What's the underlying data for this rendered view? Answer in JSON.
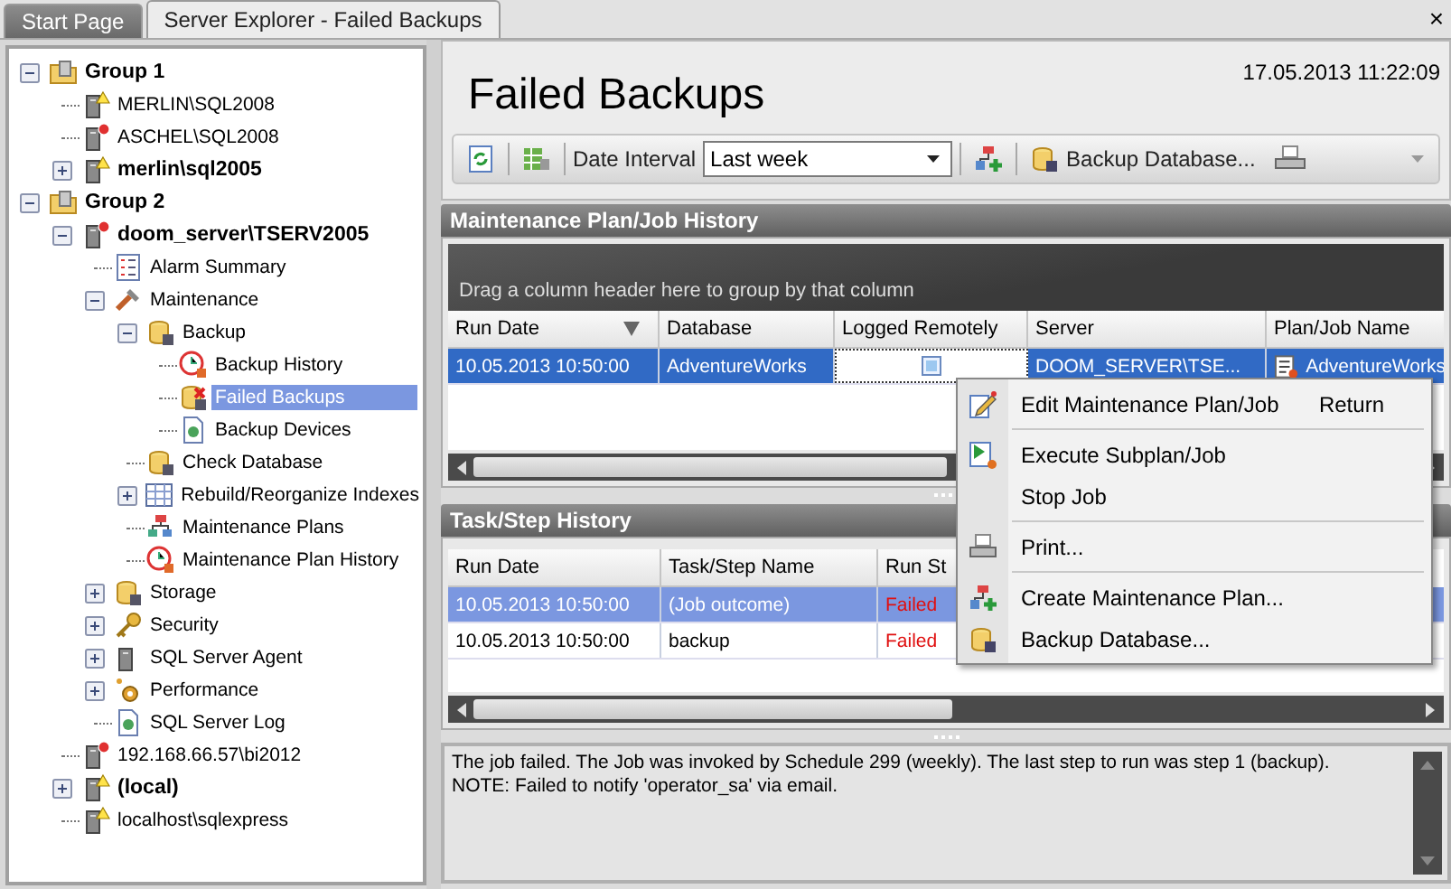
{
  "tabs": [
    {
      "label": "Start Page",
      "selected": false
    },
    {
      "label": "Server Explorer - Failed Backups",
      "selected": true
    }
  ],
  "close": "×",
  "tree": [
    {
      "label": "Group 1",
      "kind": "group",
      "bold": true,
      "selected": false,
      "expanded": true,
      "children": [
        {
          "label": "MERLIN\\SQL2008",
          "kind": "server",
          "warning": true,
          "error": false,
          "bold": false,
          "selected": false
        },
        {
          "label": "ASCHEL\\SQL2008",
          "kind": "server",
          "warning": false,
          "error": true,
          "bold": false,
          "selected": false
        },
        {
          "label": "merlin\\sql2005",
          "kind": "server",
          "warning": true,
          "error": false,
          "bold": true,
          "selected": false,
          "expanded": false
        }
      ]
    },
    {
      "label": "Group 2",
      "kind": "group",
      "bold": true,
      "selected": false,
      "expanded": true,
      "children": [
        {
          "label": "doom_server\\TSERV2005",
          "kind": "server",
          "warning": false,
          "error": true,
          "bold": true,
          "selected": false,
          "expanded": true,
          "children": [
            {
              "label": "Alarm Summary",
              "kind": "alarm",
              "bold": false,
              "selected": false
            },
            {
              "label": "Maintenance",
              "kind": "maintenance",
              "bold": false,
              "selected": false,
              "expanded": true,
              "children": [
                {
                  "label": "Backup",
                  "kind": "backup",
                  "bold": false,
                  "selected": false,
                  "expanded": true,
                  "children": [
                    {
                      "label": "Backup History",
                      "kind": "history",
                      "bold": false,
                      "selected": false
                    },
                    {
                      "label": "Failed Backups",
                      "kind": "failed",
                      "bold": false,
                      "selected": true
                    },
                    {
                      "label": "Backup Devices",
                      "kind": "device",
                      "bold": false,
                      "selected": false
                    }
                  ]
                },
                {
                  "label": "Check Database",
                  "kind": "check",
                  "bold": false,
                  "selected": false
                },
                {
                  "label": "Rebuild/Reorganize Indexes",
                  "kind": "indexes",
                  "bold": false,
                  "selected": false,
                  "expanded": false
                },
                {
                  "label": "Maintenance Plans",
                  "kind": "plans",
                  "bold": false,
                  "selected": false
                },
                {
                  "label": "Maintenance Plan History",
                  "kind": "history",
                  "bold": false,
                  "selected": false
                }
              ]
            },
            {
              "label": "Storage",
              "kind": "storage",
              "bold": false,
              "selected": false,
              "expanded": false
            },
            {
              "label": "Security",
              "kind": "security",
              "bold": false,
              "selected": false,
              "expanded": false
            },
            {
              "label": "SQL Server Agent",
              "kind": "agent",
              "bold": false,
              "selected": false,
              "expanded": false
            },
            {
              "label": "Performance",
              "kind": "performance",
              "bold": false,
              "selected": false,
              "expanded": false
            },
            {
              "label": "SQL Server Log",
              "kind": "log",
              "bold": false,
              "selected": false
            }
          ]
        },
        {
          "label": "192.168.66.57\\bi2012",
          "kind": "server",
          "warning": false,
          "error": true,
          "bold": false,
          "selected": false
        },
        {
          "label": "(local)",
          "kind": "server",
          "warning": true,
          "error": false,
          "bold": true,
          "selected": false,
          "expanded": false
        },
        {
          "label": "localhost\\sqlexpress",
          "kind": "server",
          "warning": true,
          "error": false,
          "bold": false,
          "selected": false
        }
      ]
    }
  ],
  "page": {
    "title": "Failed Backups",
    "timestamp": "17.05.2013 11:22:09"
  },
  "toolbar": {
    "date_label": "Date Interval",
    "date_value": "Last week",
    "backup_button": "Backup Database..."
  },
  "job_history": {
    "title": "Maintenance Plan/Job History",
    "group_hint": "Drag a column header here to group by that column",
    "columns": [
      {
        "label": "Run Date",
        "sorted": true
      },
      {
        "label": "Database",
        "sorted": false
      },
      {
        "label": "Logged Remotely",
        "sorted": false
      },
      {
        "label": "Server",
        "sorted": false
      },
      {
        "label": "Plan/Job Name",
        "sorted": false
      }
    ],
    "rows": [
      {
        "selected": true,
        "run_date": "10.05.2013 10:50:00",
        "database": "AdventureWorks",
        "logged_remotely": false,
        "server": "DOOM_SERVER\\TSE...",
        "plan_job_name": "AdventureWorks"
      }
    ]
  },
  "step_history": {
    "title": "Task/Step History",
    "columns": [
      {
        "label": "Run Date"
      },
      {
        "label": "Task/Step Name"
      },
      {
        "label": "Run St"
      }
    ],
    "rows": [
      {
        "selected": true,
        "run_date": "10.05.2013 10:50:00",
        "task_step_name": "(Job outcome)",
        "run_status": "Failed",
        "failed": true
      },
      {
        "selected": false,
        "run_date": "10.05.2013 10:50:00",
        "task_step_name": "backup",
        "run_status": "Failed",
        "failed": true
      }
    ]
  },
  "message": "The job failed.  The Job was invoked by Schedule 299 (weekly).  The last step to run was step 1 (backup).\nNOTE: Failed to notify 'operator_sa' via email.",
  "context_menu": {
    "items": [
      {
        "kind": "edit",
        "label": "Edit Maintenance Plan/Job",
        "shortcut": "Return"
      },
      {
        "kind": "separator"
      },
      {
        "kind": "execute",
        "label": "Execute Subplan/Job"
      },
      {
        "kind": "plain",
        "label": "Stop Job"
      },
      {
        "kind": "separator"
      },
      {
        "kind": "print",
        "label": "Print..."
      },
      {
        "kind": "separator"
      },
      {
        "kind": "create",
        "label": "Create Maintenance Plan..."
      },
      {
        "kind": "backup",
        "label": "Backup Database..."
      }
    ]
  }
}
